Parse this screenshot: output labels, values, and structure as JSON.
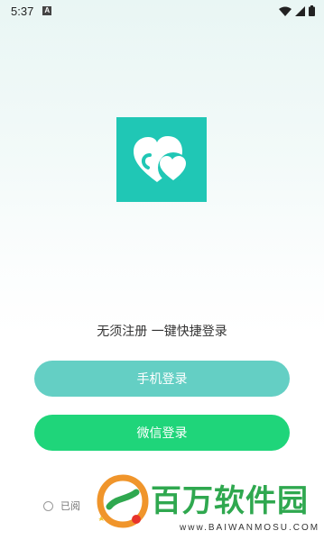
{
  "status_bar": {
    "time": "5:37",
    "notification_letter": "A"
  },
  "tagline": "无须注册 一键快捷登录",
  "buttons": {
    "phone_login": "手机登录",
    "wechat_login": "微信登录"
  },
  "agreement": {
    "text": "已阅"
  },
  "watermark": {
    "title": "百万软件园",
    "url": "www.BAIWANMOSU.COM"
  },
  "colors": {
    "brand_teal": "#20c7b5",
    "phone_button": "#64cfc4",
    "wechat_button": "#1fd57a",
    "watermark_green": "#2fa84f"
  }
}
